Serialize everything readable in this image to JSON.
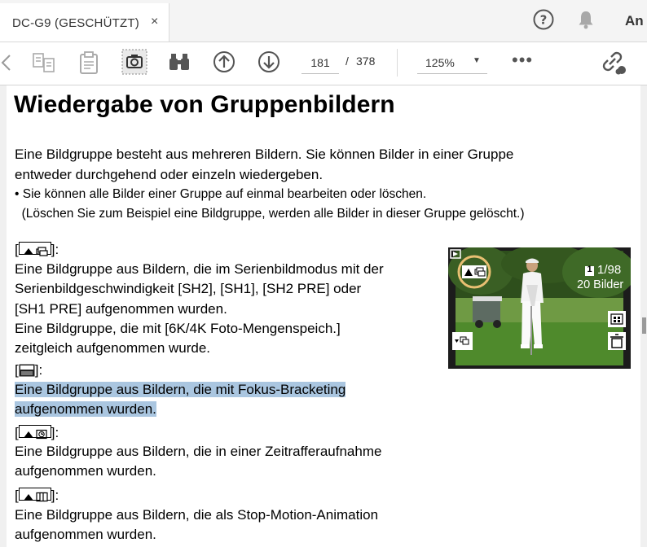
{
  "tab": {
    "title": "DC-G9 (GESCHÜTZT)",
    "close": "×",
    "user_label": "An"
  },
  "toolbar": {
    "current_page": "181",
    "page_separator": "/",
    "total_pages": "378",
    "zoom": "125%",
    "more": "•••"
  },
  "icons": {
    "help": "help-icon",
    "bell": "notification-bell-icon",
    "back": "chevron-left-icon",
    "compare": "compare-pages-icon",
    "clipboard": "clipboard-icon",
    "snapshot": "camera-snapshot-icon",
    "find": "binoculars-icon",
    "page_up": "arrow-up-circle-icon",
    "page_down": "arrow-down-circle-icon",
    "zoom_dropdown": "caret-down-icon",
    "share": "link-share-icon"
  },
  "document": {
    "heading": "Wiedergabe von Gruppenbildern",
    "intro_lines": [
      "Eine Bildgruppe besteht aus mehreren Bildern. Sie können Bilder in einer Gruppe",
      "entweder durchgehend oder einzeln wiedergeben."
    ],
    "bullet_lines": [
      "• Sie können alle Bilder einer Gruppe auf einmal bearbeiten oder löschen.",
      "  (Löschen Sie zum Beispiel eine Bildgruppe, werden alle Bilder in dieser Gruppe gelöscht.)"
    ],
    "sections": [
      {
        "bracket_open": "[",
        "bracket_close": "]:",
        "lines": [
          "Eine Bildgruppe aus Bildern, die im Serienbildmodus mit der",
          "Serienbildgeschwindigkeit [SH2], [SH1], [SH2 PRE] oder",
          "[SH1 PRE] aufgenommen wurden.",
          "Eine Bildgruppe, die mit [6K/4K Foto-Mengenspeich.]",
          "zeitgleich aufgenommen wurde."
        ]
      },
      {
        "bracket_open": "[",
        "bracket_close": "]:",
        "lines": [
          "Eine Bildgruppe aus Bildern, die mit Fokus-Bracketing",
          "aufgenommen wurden."
        ]
      },
      {
        "bracket_open": "[",
        "bracket_close": "]:",
        "lines": [
          "Eine Bildgruppe aus Bildern, die in einer Zeitrafferaufnahme",
          "aufgenommen wurden."
        ]
      },
      {
        "bracket_open": "[",
        "bracket_close": "]:",
        "lines": [
          "Eine Bildgruppe aus Bildern, die als Stop-Motion-Animation",
          "aufgenommen wurden."
        ]
      }
    ],
    "photo": {
      "counter_badge": "1",
      "counter": "1/98",
      "count_label": "20 Bilder"
    }
  }
}
